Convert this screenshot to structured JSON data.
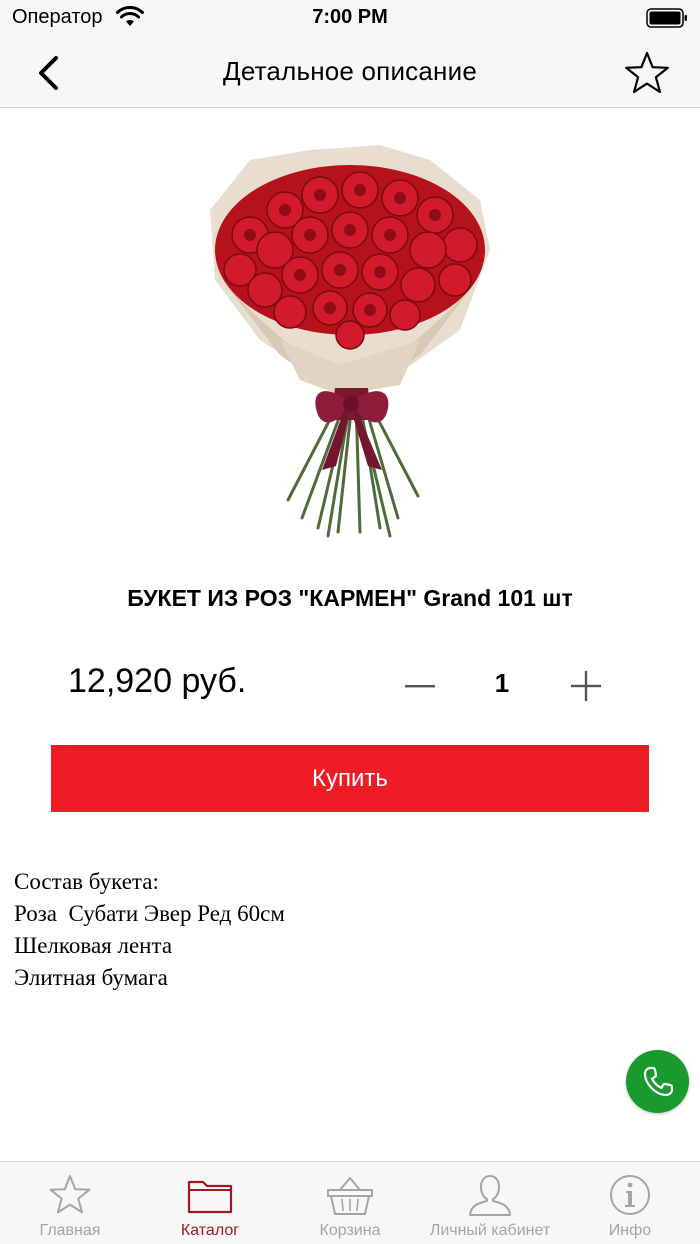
{
  "status_bar": {
    "carrier": "Оператор",
    "time": "7:00 PM"
  },
  "nav": {
    "title": "Детальное описание",
    "back_icon": "chevron-left-icon",
    "favorite_icon": "star-outline-icon"
  },
  "product": {
    "image": "red-rose-bouquet",
    "title": "БУКЕТ ИЗ РОЗ \"КАРМЕН\" Grand 101 шт",
    "price": "12,920 руб.",
    "quantity": "1"
  },
  "buy_button": {
    "label": "Купить"
  },
  "description": {
    "lines": [
      "Состав букета:",
      "Роза  Субати Эвер Ред 60см",
      "Шелковая лента",
      "Элитная бумага"
    ]
  },
  "call_button": {
    "icon": "phone-icon"
  },
  "tabs": [
    {
      "label": "Главная",
      "icon": "star-icon",
      "active": false
    },
    {
      "label": "Каталог",
      "icon": "folder-icon",
      "active": true
    },
    {
      "label": "Корзина",
      "icon": "basket-icon",
      "active": false
    },
    {
      "label": "Личный кабинет",
      "icon": "person-icon",
      "active": false
    },
    {
      "label": "Инфо",
      "icon": "info-icon",
      "active": false
    }
  ],
  "colors": {
    "accent": "#ee1c25",
    "active_tab": "#9a1c22",
    "call_green": "#1a9a2e"
  }
}
